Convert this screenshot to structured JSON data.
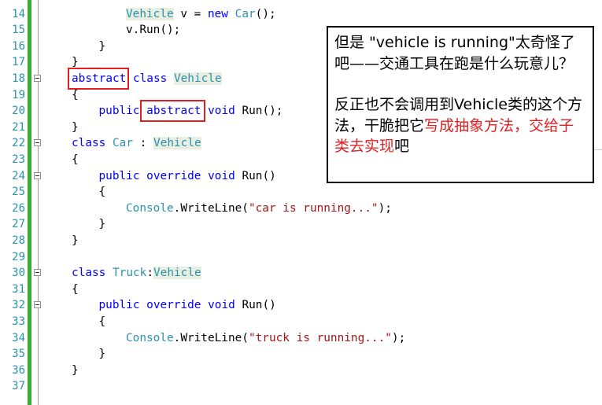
{
  "editor": {
    "lines": [
      {
        "num": "14",
        "indent": 3,
        "tokens": [
          {
            "t": "Vehicle",
            "c": "ty hl"
          },
          {
            "t": " v = ",
            "c": ""
          },
          {
            "t": "new",
            "c": "kw"
          },
          {
            "t": " ",
            "c": ""
          },
          {
            "t": "Car",
            "c": "ty"
          },
          {
            "t": "();",
            "c": ""
          }
        ]
      },
      {
        "num": "15",
        "indent": 3,
        "tokens": [
          {
            "t": "v.Run();",
            "c": ""
          }
        ]
      },
      {
        "num": "16",
        "indent": 2,
        "tokens": [
          {
            "t": "}",
            "c": ""
          }
        ]
      },
      {
        "num": "17",
        "indent": 1,
        "tokens": [
          {
            "t": "}",
            "c": ""
          }
        ]
      },
      {
        "num": "18",
        "indent": 1,
        "fold": true,
        "tokens": [
          {
            "t": "abstract",
            "c": "kw"
          },
          {
            "t": " ",
            "c": ""
          },
          {
            "t": "class",
            "c": "kw"
          },
          {
            "t": " ",
            "c": ""
          },
          {
            "t": "Vehicle",
            "c": "ty hl"
          }
        ]
      },
      {
        "num": "19",
        "indent": 1,
        "tokens": [
          {
            "t": "{",
            "c": ""
          }
        ]
      },
      {
        "num": "20",
        "indent": 2,
        "tokens": [
          {
            "t": "public",
            "c": "kw"
          },
          {
            "t": " ",
            "c": ""
          },
          {
            "t": "abstract",
            "c": "kw"
          },
          {
            "t": " ",
            "c": ""
          },
          {
            "t": "void",
            "c": "kw"
          },
          {
            "t": " Run();",
            "c": ""
          }
        ]
      },
      {
        "num": "21",
        "indent": 1,
        "tokens": [
          {
            "t": "}",
            "c": ""
          }
        ]
      },
      {
        "num": "22",
        "indent": 1,
        "fold": true,
        "tokens": [
          {
            "t": "class",
            "c": "kw"
          },
          {
            "t": " ",
            "c": ""
          },
          {
            "t": "Car",
            "c": "ty"
          },
          {
            "t": " : ",
            "c": ""
          },
          {
            "t": "Vehicle",
            "c": "ty hl"
          }
        ]
      },
      {
        "num": "23",
        "indent": 1,
        "tokens": [
          {
            "t": "{",
            "c": ""
          }
        ]
      },
      {
        "num": "24",
        "indent": 2,
        "fold": true,
        "tokens": [
          {
            "t": "public",
            "c": "kw"
          },
          {
            "t": " ",
            "c": ""
          },
          {
            "t": "override",
            "c": "kw"
          },
          {
            "t": " ",
            "c": ""
          },
          {
            "t": "void",
            "c": "kw"
          },
          {
            "t": " Run()",
            "c": ""
          }
        ]
      },
      {
        "num": "25",
        "indent": 2,
        "tokens": [
          {
            "t": "{",
            "c": ""
          }
        ]
      },
      {
        "num": "26",
        "indent": 3,
        "tokens": [
          {
            "t": "Console",
            "c": "ty"
          },
          {
            "t": ".WriteLine(",
            "c": ""
          },
          {
            "t": "\"car is running...\"",
            "c": "str"
          },
          {
            "t": ");",
            "c": ""
          }
        ]
      },
      {
        "num": "27",
        "indent": 2,
        "tokens": [
          {
            "t": "}",
            "c": ""
          }
        ]
      },
      {
        "num": "28",
        "indent": 1,
        "tokens": [
          {
            "t": "}",
            "c": ""
          }
        ]
      },
      {
        "num": "29",
        "indent": 0,
        "tokens": []
      },
      {
        "num": "30",
        "indent": 1,
        "fold": true,
        "tokens": [
          {
            "t": "class",
            "c": "kw"
          },
          {
            "t": " ",
            "c": ""
          },
          {
            "t": "Truck",
            "c": "ty"
          },
          {
            "t": ":",
            "c": ""
          },
          {
            "t": "Vehicle",
            "c": "ty hl"
          }
        ]
      },
      {
        "num": "31",
        "indent": 1,
        "tokens": [
          {
            "t": "{",
            "c": ""
          }
        ]
      },
      {
        "num": "32",
        "indent": 2,
        "fold": true,
        "tokens": [
          {
            "t": "public",
            "c": "kw"
          },
          {
            "t": " ",
            "c": ""
          },
          {
            "t": "override",
            "c": "kw"
          },
          {
            "t": " ",
            "c": ""
          },
          {
            "t": "void",
            "c": "kw"
          },
          {
            "t": " Run()",
            "c": ""
          }
        ]
      },
      {
        "num": "33",
        "indent": 2,
        "tokens": [
          {
            "t": "{",
            "c": ""
          }
        ]
      },
      {
        "num": "34",
        "indent": 3,
        "tokens": [
          {
            "t": "Console",
            "c": "ty"
          },
          {
            "t": ".WriteLine(",
            "c": ""
          },
          {
            "t": "\"truck is running...\"",
            "c": "str"
          },
          {
            "t": ");",
            "c": ""
          }
        ]
      },
      {
        "num": "35",
        "indent": 2,
        "tokens": [
          {
            "t": "}",
            "c": ""
          }
        ]
      },
      {
        "num": "36",
        "indent": 1,
        "tokens": [
          {
            "t": "}",
            "c": ""
          }
        ]
      },
      {
        "num": "37",
        "indent": 0,
        "tokens": []
      }
    ]
  },
  "annotation": {
    "para1": "但是 \"vehicle is running\"太奇怪了吧——交通工具在跑是什么玩意儿？",
    "para2_prefix": "反正也不会调用到Vehicle类的这个方法，干脆把它",
    "para2_red": "写成抽象方法，交给子类去实现",
    "para2_suffix": "吧"
  },
  "colors": {
    "keyword": "#0000ff",
    "type": "#2b91af",
    "string": "#a31515",
    "line_number": "#2b91af",
    "gutter_change_bar": "#35b035",
    "highlight_box": "#e02020"
  }
}
